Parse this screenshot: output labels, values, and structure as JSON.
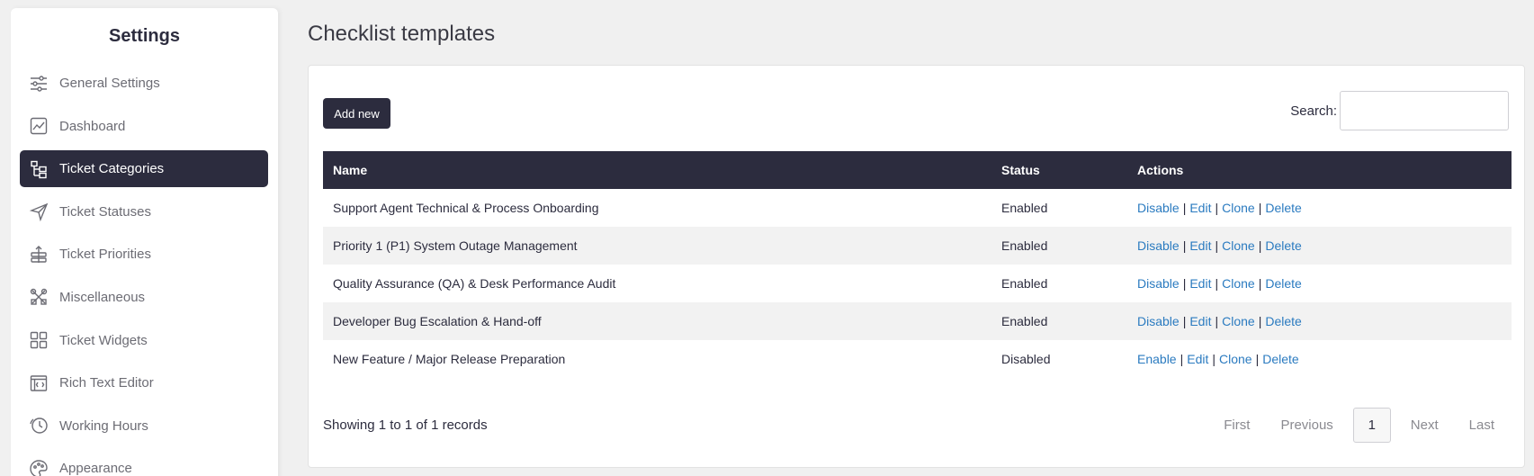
{
  "sidebar": {
    "title": "Settings",
    "items": [
      {
        "label": "General Settings",
        "icon": "sliders-icon"
      },
      {
        "label": "Dashboard",
        "icon": "chart-icon"
      },
      {
        "label": "Ticket Categories",
        "icon": "tree-icon",
        "active": true
      },
      {
        "label": "Ticket Statuses",
        "icon": "send-icon"
      },
      {
        "label": "Ticket Priorities",
        "icon": "priority-icon"
      },
      {
        "label": "Miscellaneous",
        "icon": "tools-icon"
      },
      {
        "label": "Ticket Widgets",
        "icon": "widgets-icon"
      },
      {
        "label": "Rich Text Editor",
        "icon": "code-icon"
      },
      {
        "label": "Working Hours",
        "icon": "clock-icon"
      },
      {
        "label": "Appearance",
        "icon": "palette-icon"
      }
    ]
  },
  "page": {
    "title": "Checklist templates"
  },
  "toolbar": {
    "add_label": "Add new",
    "search_label": "Search:",
    "search_value": ""
  },
  "table": {
    "headers": [
      "Name",
      "Status",
      "Actions"
    ],
    "rows": [
      {
        "name": "Support Agent Technical & Process Onboarding",
        "status": "Enabled",
        "toggle": "Disable"
      },
      {
        "name": "Priority 1 (P1) System Outage Management",
        "status": "Enabled",
        "toggle": "Disable"
      },
      {
        "name": "Quality Assurance (QA) & Desk Performance Audit",
        "status": "Enabled",
        "toggle": "Disable"
      },
      {
        "name": "Developer Bug Escalation & Hand-off",
        "status": "Enabled",
        "toggle": "Disable"
      },
      {
        "name": "New Feature / Major Release Preparation",
        "status": "Disabled",
        "toggle": "Enable"
      }
    ],
    "actions": {
      "edit": "Edit",
      "clone": "Clone",
      "delete": "Delete",
      "separator": "|"
    }
  },
  "footer": {
    "info": "Showing 1 to 1 of 1 records",
    "pager": {
      "first": "First",
      "previous": "Previous",
      "current": "1",
      "next": "Next",
      "last": "Last"
    }
  },
  "colors": {
    "accent": "#2c2c3e",
    "link": "#2b7bc0",
    "background": "#f0f0f0"
  }
}
